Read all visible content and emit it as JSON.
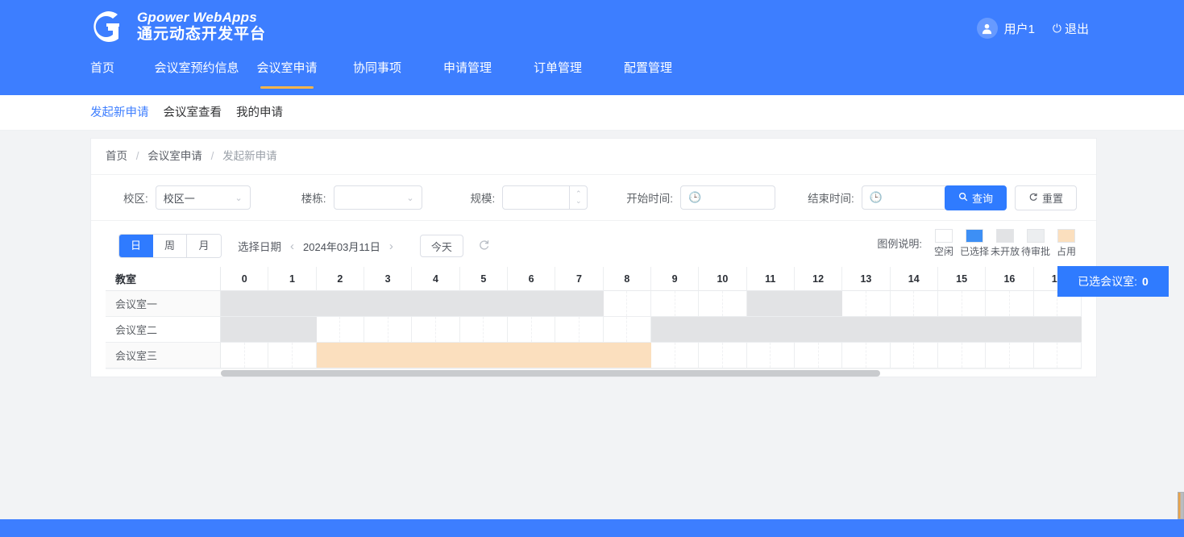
{
  "header": {
    "brand_en": "Gpower WebApps",
    "brand_cn": "通元动态开发平台",
    "logo_icon": "gpower-logo-icon",
    "avatar_icon": "user-avatar-icon",
    "user_name": "用户1",
    "logout_icon": "power-icon",
    "logout_label": "退出",
    "brand_color": "#3d7eff"
  },
  "main_nav": {
    "items": [
      {
        "label": "首页",
        "active": false
      },
      {
        "label": "会议室预约信息",
        "active": false
      },
      {
        "label": "会议室申请",
        "active": true
      },
      {
        "label": "协同事项",
        "active": false
      },
      {
        "label": "申请管理",
        "active": false
      },
      {
        "label": "订单管理",
        "active": false
      },
      {
        "label": "配置管理",
        "active": false
      }
    ],
    "active_underline_color": "#f5b44a"
  },
  "sub_nav": {
    "items": [
      {
        "label": "发起新申请",
        "active": true
      },
      {
        "label": "会议室查看",
        "active": false
      },
      {
        "label": "我的申请",
        "active": false
      }
    ]
  },
  "breadcrumb": {
    "items": [
      "首页",
      "会议室申请",
      "发起新申请"
    ],
    "separator": "/"
  },
  "filters": {
    "campus": {
      "label": "校区:",
      "value": "校区一",
      "placeholder": "",
      "caret_icon": "chevron-down-icon"
    },
    "building": {
      "label": "楼栋:",
      "value": "",
      "placeholder": "",
      "caret_icon": "chevron-down-icon"
    },
    "scale": {
      "label": "规模:",
      "value": "",
      "placeholder": "",
      "stepper_icon": "number-stepper-icon"
    },
    "start_time": {
      "label": "开始时间:",
      "value": "",
      "placeholder": "",
      "icon": "clock-icon"
    },
    "end_time": {
      "label": "结束时间:",
      "value": "",
      "placeholder": "",
      "icon": "clock-icon"
    },
    "search_button": {
      "label": "查询",
      "icon": "search-icon"
    },
    "reset_button": {
      "label": "重置",
      "icon": "refresh-icon"
    }
  },
  "calendar_toolbar": {
    "views": [
      {
        "label": "日",
        "active": true
      },
      {
        "label": "周",
        "active": false
      },
      {
        "label": "月",
        "active": false
      }
    ],
    "date_picker_label": "选择日期",
    "prev_icon": "chevron-left-icon",
    "next_icon": "chevron-right-icon",
    "current_date": "2024年03月11日",
    "today_button": "今天",
    "refresh_icon": "refresh-icon"
  },
  "legend": {
    "title": "图例说明:",
    "items": [
      {
        "label": "空闲",
        "color": "#ffffff"
      },
      {
        "label": "已选择",
        "color": "#3d8ff5"
      },
      {
        "label": "未开放",
        "color": "#e2e3e5"
      },
      {
        "label": "待审批",
        "color": "#eceef0"
      },
      {
        "label": "占用",
        "color": "#fbdfbe"
      }
    ]
  },
  "schedule": {
    "room_column_header": "教室",
    "hours": [
      "0",
      "1",
      "2",
      "3",
      "4",
      "5",
      "6",
      "7",
      "8",
      "9",
      "10",
      "11",
      "12",
      "13",
      "14",
      "15",
      "16",
      "17"
    ],
    "rows": [
      {
        "room": "会议室一",
        "cells": [
          "closed",
          "closed",
          "closed",
          "closed",
          "closed",
          "closed",
          "closed",
          "closed",
          "free",
          "free",
          "free",
          "closed",
          "closed",
          "free",
          "free",
          "free",
          "free",
          "free"
        ]
      },
      {
        "room": "会议室二",
        "cells": [
          "closed",
          "closed",
          "free",
          "free",
          "free",
          "free",
          "free",
          "free",
          "free",
          "closed",
          "closed",
          "closed",
          "closed",
          "closed",
          "closed",
          "closed",
          "closed",
          "closed"
        ]
      },
      {
        "room": "会议室三",
        "cells": [
          "free",
          "free",
          "occupied",
          "occupied",
          "occupied",
          "occupied",
          "occupied",
          "occupied",
          "occupied",
          "free",
          "free",
          "free",
          "free",
          "free",
          "free",
          "free",
          "free",
          "free"
        ]
      }
    ],
    "scrollbar": "horizontal-scrollbar"
  },
  "selected_badge": {
    "label": "已选会议室:",
    "count": "0",
    "color": "#2f7bff"
  }
}
